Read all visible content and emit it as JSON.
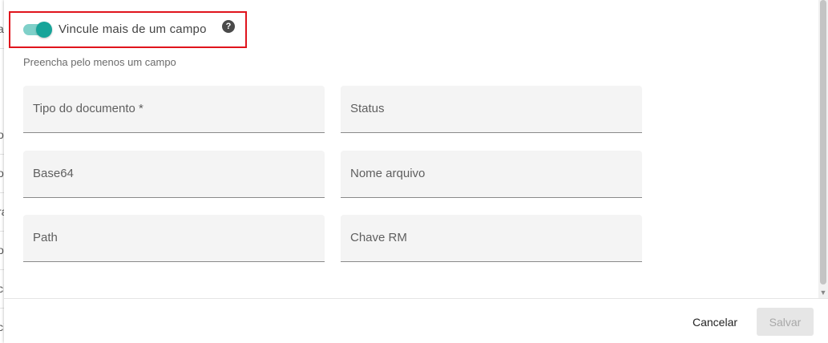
{
  "background_rows": [
    "a",
    "o",
    "o",
    "ra",
    "o",
    "ci",
    "ci"
  ],
  "toggle": {
    "label": "Vincule mais de um campo",
    "checked": true,
    "accent": "#17a499"
  },
  "help_icon": {
    "glyph": "?"
  },
  "hint": "Preencha pelo menos um campo",
  "fields": [
    {
      "label": "Tipo do documento *",
      "value": ""
    },
    {
      "label": "Status",
      "value": ""
    },
    {
      "label": "Base64",
      "value": ""
    },
    {
      "label": "Nome arquivo",
      "value": ""
    },
    {
      "label": "Path",
      "value": ""
    },
    {
      "label": "Chave RM",
      "value": ""
    }
  ],
  "footer": {
    "cancel_label": "Cancelar",
    "save_label": "Salvar",
    "save_disabled": true
  },
  "colors": {
    "highlight": "#e0141d",
    "field_bg": "#f4f4f4"
  }
}
